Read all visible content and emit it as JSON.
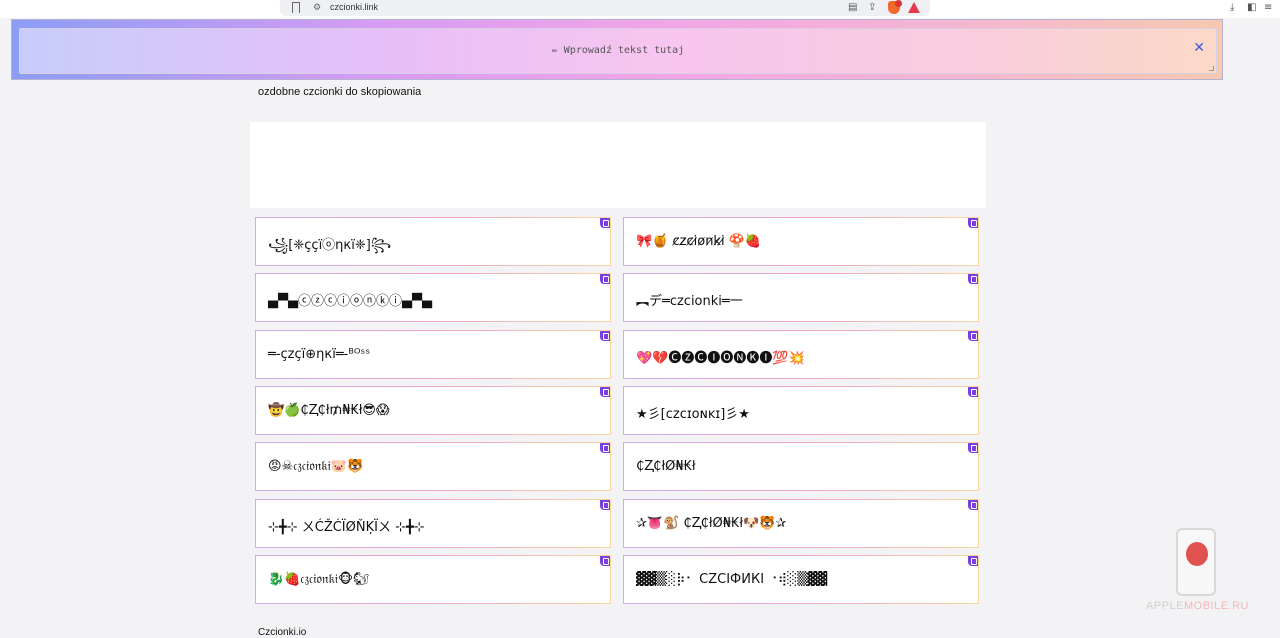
{
  "browser": {
    "url": "czcionki.link"
  },
  "input": {
    "placeholder": "✏ Wprowadź tekst tutaj",
    "close_icon": "close-icon"
  },
  "heading": "ozdobne czcionki do skopiowania",
  "cards": [
    "꧁[❈ççïⓞηкï❈]꧂",
    "🎀🍯 c̷z̷c̷i̷o̷n̷k̷i̷ 🍄🍓",
    "▄▀▄ⓒⓩⓒⓘⓞⓝⓚⓘ▄▀▄",
    "︻デ═czcionki═一",
    "═-çzçï⊕ηкï═-ᴮᴼˢˢ",
    "💖💔🅒🅩🅒🅘🅞🅝🅚🅘💯💥",
    "🤠🍏₵Ⱬ₵ł₥₦₭ł😎😱",
    "★彡[ᴄᴢᴄɪᴏɴᴋɪ]彡★",
    "😡☠𝔠𝔷𝔠𝔦𝔬𝔫𝔨𝔦🐷🐯",
    "₵Ⱬ₵łØ₦₭ł",
    "⊹╋⊹ ㄨĆŽĆÏØŇĶÏㄨ ⊹╋⊹",
    "✰👅🐒 ₵Ⱬ₵łØ₦₭ł🐶🐯✰",
    "🐉🍓𝔠𝔷𝔠𝔦𝔬𝔫𝔨𝔦🐵🐿",
    "▓▓▒░⡷⠂ CZCIФИКI ⠐⢾░▒▓▓"
  ],
  "footer_label": "Czcionki.io",
  "watermark": {
    "brand_a": "APPLE",
    "brand_b": "MOBILE.RU"
  }
}
